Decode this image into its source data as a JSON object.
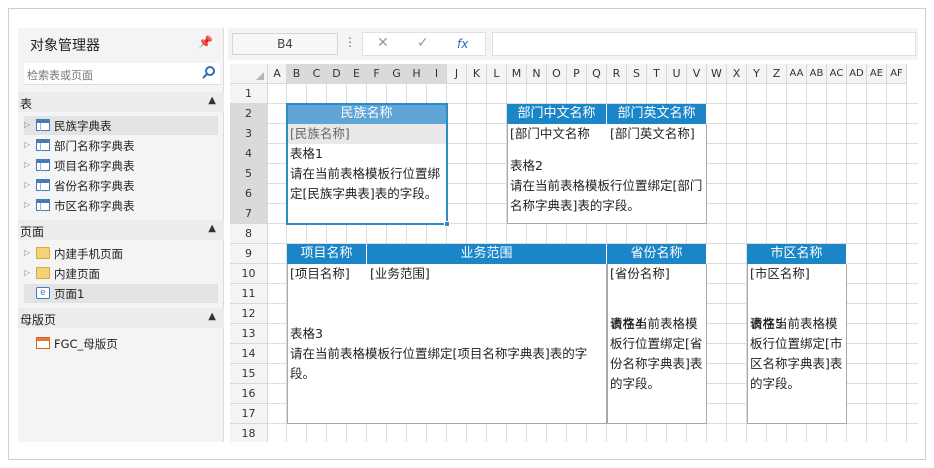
{
  "object_manager": {
    "title": "对象管理器",
    "search_placeholder": "检索表或页面",
    "sections": {
      "tables": "表",
      "pages": "页面",
      "master_pages": "母版页"
    },
    "tables": [
      "民族字典表",
      "部门名称字典表",
      "项目名称字典表",
      "省份名称字典表",
      "市区名称字典表"
    ],
    "pages": [
      "内建手机页面",
      "内建页面",
      "页面1"
    ],
    "master_pages": [
      "FGC_母版页"
    ]
  },
  "toolbar": {
    "name_box": "B4",
    "dots": "⋮",
    "cancel": "✕",
    "confirm": "✓",
    "fx": "fx"
  },
  "grid": {
    "columns": [
      "A",
      "B",
      "C",
      "D",
      "E",
      "F",
      "G",
      "H",
      "I",
      "J",
      "K",
      "L",
      "M",
      "N",
      "O",
      "P",
      "Q",
      "R",
      "S",
      "T",
      "U",
      "V",
      "W",
      "X",
      "Y",
      "Z",
      "AA",
      "AB",
      "AC",
      "AD",
      "AE",
      "AF"
    ],
    "rows": [
      "1",
      "2",
      "3",
      "4",
      "5",
      "6",
      "7",
      "8",
      "9",
      "10",
      "11",
      "12",
      "13",
      "14",
      "15",
      "16",
      "17",
      "18"
    ]
  },
  "tables": {
    "t1": {
      "headers": [
        "民族名称"
      ],
      "fields": [
        "[民族名称]"
      ],
      "note_title": "表格1",
      "note_body": "请在当前表格模板行位置绑定[民族字典表]表的字段。"
    },
    "t2": {
      "headers": [
        "部门中文名称",
        "部门英文名称"
      ],
      "fields": [
        "[部门中文名称",
        "[部门英文名称]"
      ],
      "note_title": "表格2",
      "note_body": "请在当前表格模板行位置绑定[部门名称字典表]表的字段。"
    },
    "t3": {
      "headers": [
        "项目名称",
        "业务范围"
      ],
      "fields": [
        "[项目名称]",
        "[业务范围]"
      ],
      "note_title": "表格3",
      "note_body": "请在当前表格模板行位置绑定[项目名称字典表]表的字段。"
    },
    "t4": {
      "headers": [
        "省份名称"
      ],
      "fields": [
        "[省份名称]"
      ],
      "note_title": "表格4",
      "note_body": "请在当前表格模板行位置绑定[省份名称字典表]表的字段。"
    },
    "t5": {
      "headers": [
        "市区名称"
      ],
      "fields": [
        "[市区名称]"
      ],
      "note_title": "表格5",
      "note_body": "请在当前表格模板行位置绑定[市区名称字典表]表的字段。"
    }
  },
  "colors": {
    "header_blue": "#1a86c8",
    "selected_header": "#5fa6d6",
    "selection_border": "#2e8bc9"
  }
}
